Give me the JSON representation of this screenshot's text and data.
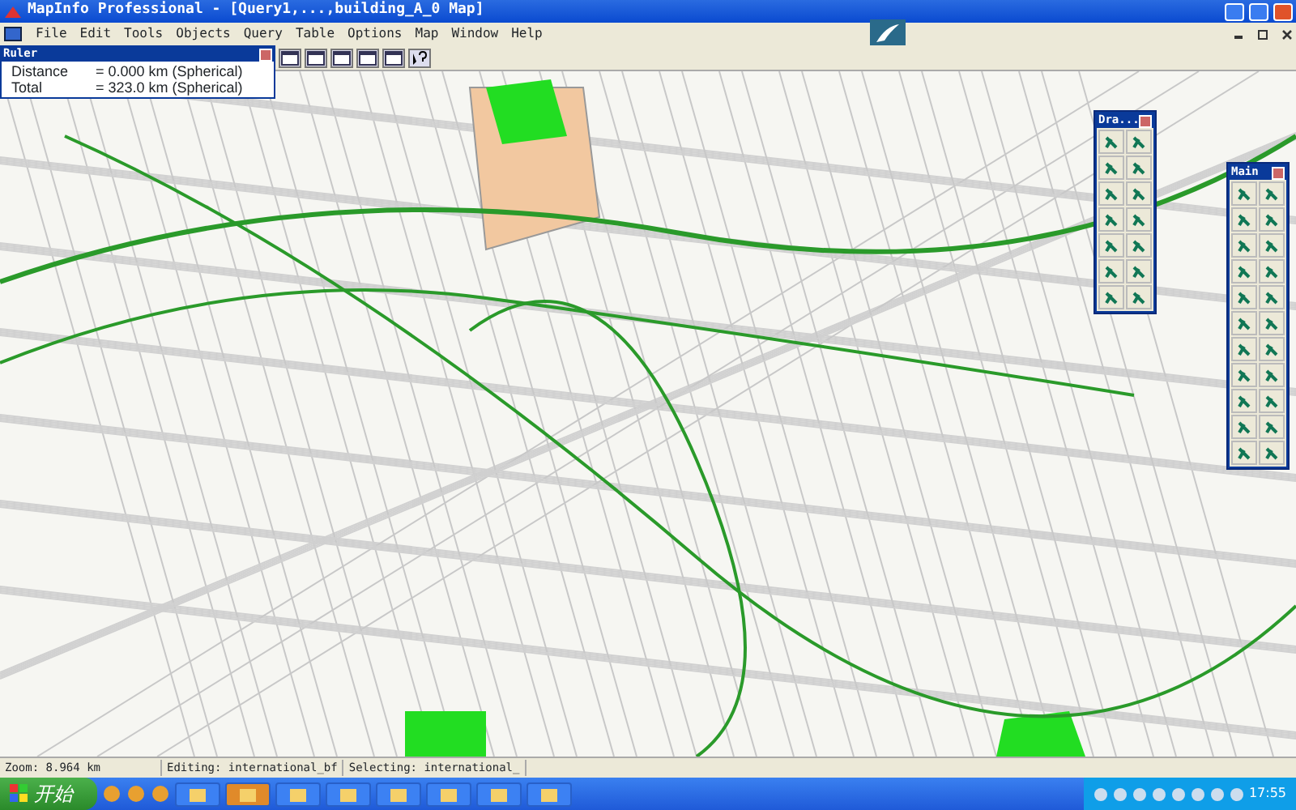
{
  "window": {
    "title": "MapInfo Professional - [Query1,...,building_A_0 Map]"
  },
  "menu": [
    "File",
    "Edit",
    "Tools",
    "Objects",
    "Query",
    "Table",
    "Options",
    "Map",
    "Window",
    "Help"
  ],
  "ruler": {
    "title": "Ruler",
    "rows": [
      {
        "label": "Distance",
        "value": "= 0.000 km (Spherical)"
      },
      {
        "label": "Total",
        "value": "= 323.0 km (Spherical)"
      }
    ]
  },
  "drawing_palette": {
    "title": "Dra..."
  },
  "main_palette": {
    "title": "Main"
  },
  "status_bar": [
    "Zoom: 8.964 km",
    "Editing: international_bf",
    "Selecting: international_"
  ],
  "taskbar": {
    "start": "开始",
    "tasks": [
      {
        "selected": false
      },
      {
        "selected": true
      },
      {
        "selected": false
      },
      {
        "selected": false
      },
      {
        "selected": false
      },
      {
        "selected": false
      },
      {
        "selected": false
      },
      {
        "selected": false
      }
    ],
    "clock": "17:55"
  }
}
